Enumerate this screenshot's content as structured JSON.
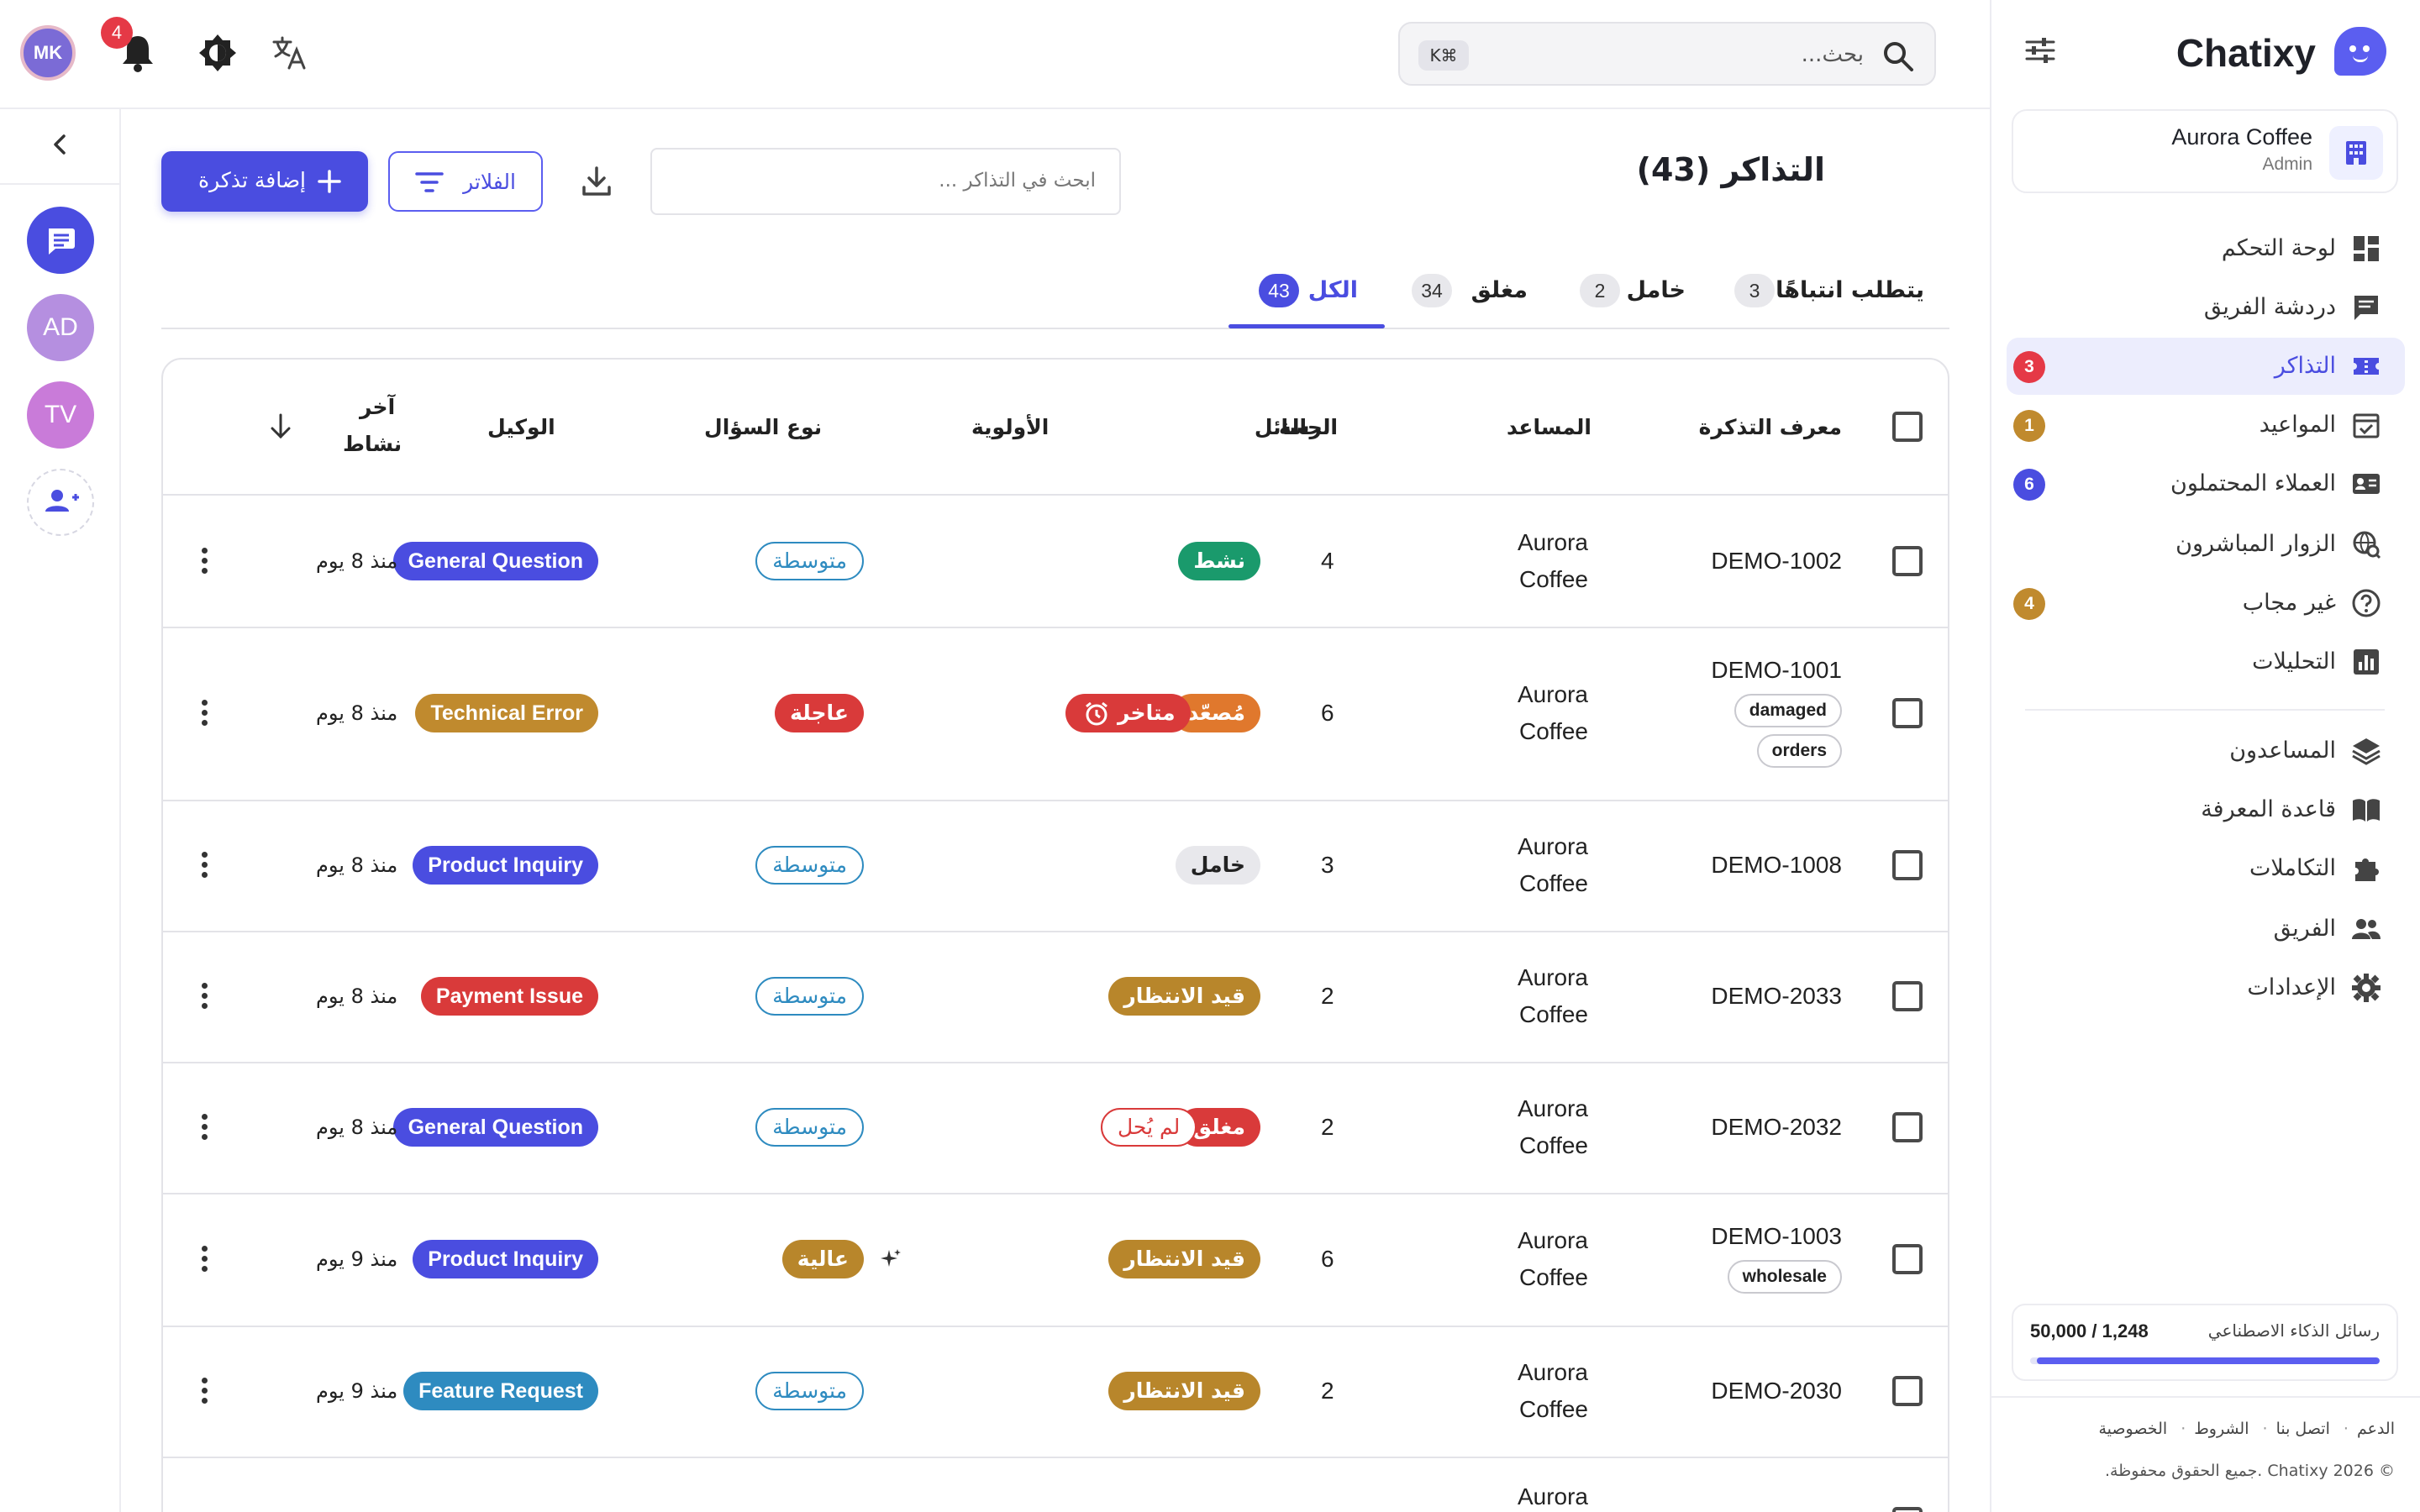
{
  "brand": {
    "name": "Chatixy"
  },
  "org": {
    "name": "Aurora Coffee",
    "role": "Admin"
  },
  "sidebar": {
    "items": [
      {
        "label": "لوحة التحكم",
        "icon": "dashboard-icon"
      },
      {
        "label": "دردشة الفريق",
        "icon": "team-chat-icon"
      },
      {
        "label": "التذاكر",
        "icon": "ticket-icon",
        "badge": "3",
        "badge_color": "#e53946"
      },
      {
        "label": "المواعيد",
        "icon": "calendar-check-icon",
        "badge": "1",
        "badge_color": "#c08a2e"
      },
      {
        "label": "العملاء المحتملون",
        "icon": "contact-card-icon",
        "badge": "6",
        "badge_color": "#4a4de0"
      },
      {
        "label": "الزوار المباشرون",
        "icon": "live-visitors-icon"
      },
      {
        "label": "غير مجاب",
        "icon": "question-icon",
        "badge": "4",
        "badge_color": "#c08a2e"
      },
      {
        "label": "التحليلات",
        "icon": "analytics-icon"
      },
      {
        "label": "المساعدون",
        "icon": "layers-icon"
      },
      {
        "label": "قاعدة المعرفة",
        "icon": "book-icon"
      },
      {
        "label": "التكاملات",
        "icon": "puzzle-icon"
      },
      {
        "label": "الفريق",
        "icon": "people-icon"
      },
      {
        "label": "الإعدادات",
        "icon": "gear-icon"
      }
    ],
    "quota": {
      "label": "رسائل الذكاء الاصطناعي",
      "value": "50,000 / 1,248",
      "fill_fraction": 0.98
    },
    "footer": {
      "links": [
        "الدعم",
        "اتصل بنا",
        "الشروط",
        "الخصوصية"
      ],
      "copyright": "© Chatixy 2026 .جميع الحقوق محفوظة."
    }
  },
  "topbar": {
    "search_placeholder": "بحث...",
    "shortcut": "K⌘",
    "avatar_initials": "MK",
    "notifications_count": "4"
  },
  "rail": {
    "avatars": [
      "AD",
      "TV"
    ]
  },
  "page": {
    "title": "التذاكر (43)",
    "ticket_search_placeholder": "ابحث في التذاكر ...",
    "filters_label": "الفلاتر",
    "add_label": "إضافة تذكرة"
  },
  "tabs": [
    {
      "label": "يتطلب انتباهًا",
      "count": "3"
    },
    {
      "label": "خامل",
      "count": "2"
    },
    {
      "label": "مغلق",
      "count": "34"
    },
    {
      "label": "الكل",
      "count": "43",
      "active": true
    }
  ],
  "table": {
    "headers": {
      "id": "معرف التذكرة",
      "assistant": "المساعد",
      "messages": "الرسائل",
      "status": "الحالة",
      "priority": "الأولوية",
      "question_type": "نوع السؤال",
      "agent": "الوكيل",
      "last_activity_1": "آخر",
      "last_activity_2": "نشاط"
    },
    "rows": [
      {
        "id": "DEMO-1002",
        "assistant_1": "Aurora",
        "assistant_2": "Coffee",
        "messages": "4",
        "status": "نشط",
        "priority": "متوسطة",
        "type": "General Question",
        "last": "منذ 8 يوم"
      },
      {
        "id": "DEMO-1001",
        "tags": [
          "damaged",
          "orders"
        ],
        "assistant_1": "Aurora",
        "assistant_2": "Coffee",
        "messages": "6",
        "status": "مُصعّد",
        "status_extra": "متاخر",
        "priority": "عاجلة",
        "type": "Technical Error",
        "last": "منذ 8 يوم"
      },
      {
        "id": "DEMO-1008",
        "assistant_1": "Aurora",
        "assistant_2": "Coffee",
        "messages": "3",
        "status": "خامل",
        "priority": "متوسطة",
        "type": "Product Inquiry",
        "last": "منذ 8 يوم"
      },
      {
        "id": "DEMO-2033",
        "assistant_1": "Aurora",
        "assistant_2": "Coffee",
        "messages": "2",
        "status": "قيد الانتظار",
        "priority": "متوسطة",
        "type": "Payment Issue",
        "last": "منذ 8 يوم"
      },
      {
        "id": "DEMO-2032",
        "assistant_1": "Aurora",
        "assistant_2": "Coffee",
        "messages": "2",
        "status": "مغلق",
        "status_extra": "لم يُحل",
        "priority": "متوسطة",
        "type": "General Question",
        "last": "منذ 8 يوم"
      },
      {
        "id": "DEMO-1003",
        "tags": [
          "wholesale"
        ],
        "assistant_1": "Aurora",
        "assistant_2": "Coffee",
        "messages": "6",
        "status": "قيد الانتظار",
        "priority": "عالية",
        "type": "Product Inquiry",
        "last": "منذ 9 يوم"
      },
      {
        "id": "DEMO-2030",
        "assistant_1": "Aurora",
        "assistant_2": "Coffee",
        "messages": "2",
        "status": "قيد الانتظار",
        "priority": "متوسطة",
        "type": "Feature Request",
        "last": "منذ 9 يوم"
      },
      {
        "assistant_1": "Aurora"
      }
    ]
  },
  "colors": {
    "accent": "#4a4de0",
    "status_active": "#1a9a6c",
    "status_pending": "#b8862b",
    "status_escalated": "#e0782d",
    "status_closed": "#d93a3a",
    "priority_urgent": "#d93a3a",
    "priority_high": "#b8862b",
    "priority_medium": "#2e8bc0",
    "type_general": "#4a4de0",
    "type_technical": "#c08a2e",
    "type_product": "#4a4de0",
    "type_payment": "#d93a3a",
    "type_feature": "#2e8bc0"
  }
}
